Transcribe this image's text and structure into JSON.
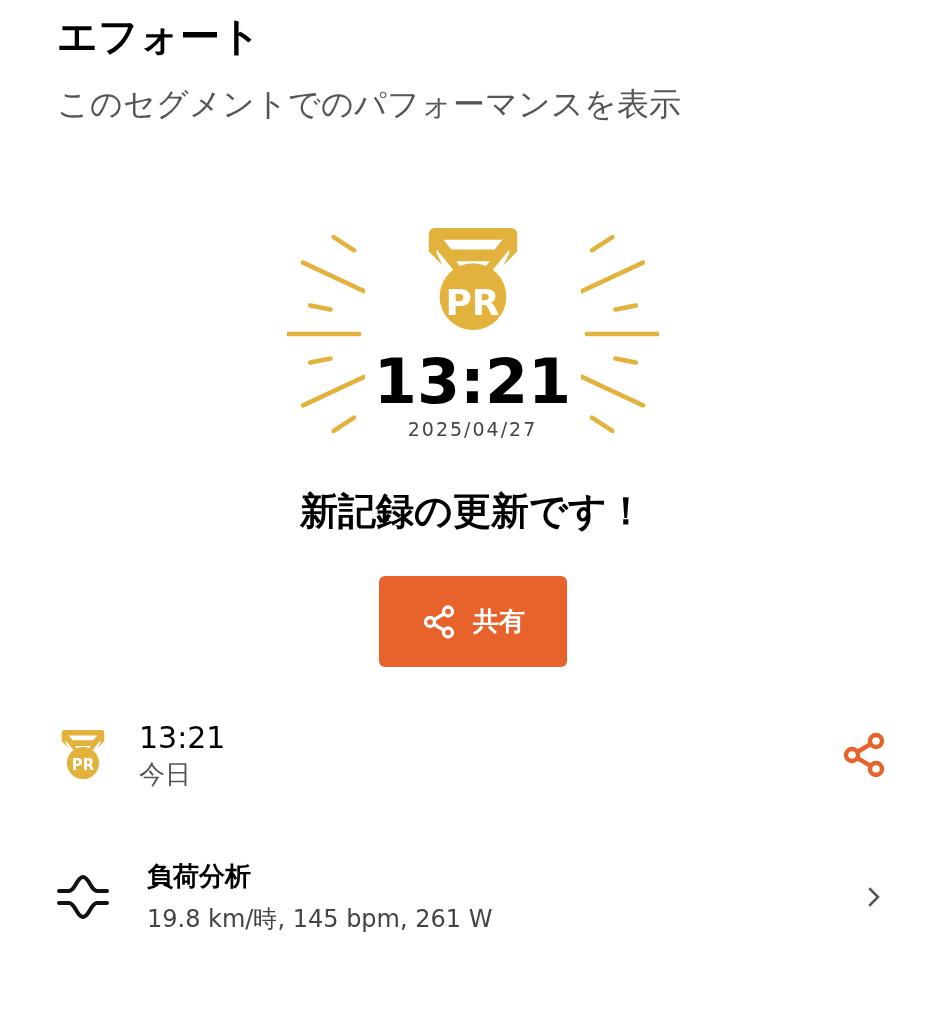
{
  "header": {
    "title": "エフォート",
    "subtitle": "このセグメントでのパフォーマンスを表示"
  },
  "record": {
    "badge": "PR",
    "time": "13:21",
    "date": "2025/04/27"
  },
  "message": "新記録の更新です！",
  "share_button": {
    "label": "共有"
  },
  "effort": {
    "badge": "PR",
    "time": "13:21",
    "when": "今日"
  },
  "analysis": {
    "title": "負荷分析",
    "details": "19.8 km/時, 145 bpm, 261 W"
  }
}
